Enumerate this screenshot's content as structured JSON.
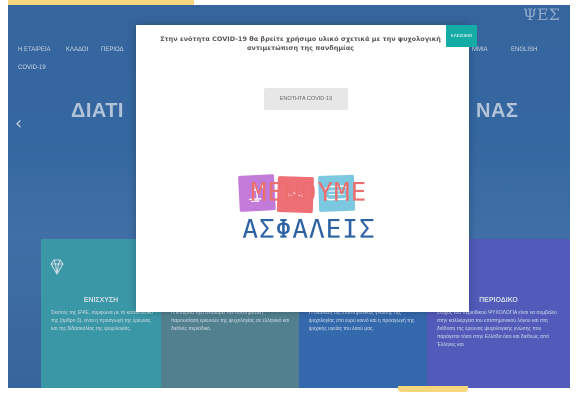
{
  "header": {
    "logo_text": "ΨΕΣ"
  },
  "nav": {
    "items": [
      "Η ΕΤΑΙΡΕΙΑ",
      "ΚΛΑΔΟΙ",
      "ΠΕΡΙΟΔ",
      "ΜΜΙΑ",
      "ENGLISH",
      "COVID-19"
    ]
  },
  "hero": {
    "title_left": "ΔΙΑΤΙ",
    "title_right": "ΝΑΣ"
  },
  "cards": [
    {
      "title": "ΕΝΙΣΧΥΣΗ",
      "text": "Σκοπός της ΕΨΕ, σύμφωνα με το καταστατικό της (άρθρο 3), είναι η προαγωγή της έρευνας και της διδασκαλίας της ψυχολογίας.",
      "color": "#3fa4b0"
    },
    {
      "title": "",
      "text": "Η Εταιρεία έχει αναλάβει την συστηματική παρουσίαση ερευνών της ψυχολογίας σε ελληνικό και διεθνές περιοδικό.",
      "color": "#5a8a95"
    },
    {
      "title": "",
      "text": "Η διάδοση της επιστημονικής γνώσης της ψυχολογίας στο ευρύ κοινό και η προαγωγή της ψυχικής υγείας του λαού μας.",
      "color": "#3970b8"
    },
    {
      "title": "ΠΕΡΙΟΔΙΚΟ",
      "text": "Στόχος του περιοδικού ΨΥΧΟΛΟΓΙΑ είναι να συμβάλει στην καλλιέργεια του επιστημονικού λόγου και στη διάδοση της έρευνας ψυχολογικής γνώσης που παράγεται τόσο στην Ελλάδα όσο και διεθνώς από Έλληνες και",
      "color": "#5b5fc7"
    }
  ],
  "modal": {
    "close_label": "ΚΛΕΙΣΙΜΟ",
    "message": "Στην ενότητα COVID-19 θα βρείτε χρήσιμο υλικό σχετικά με την ψυχολογική αντιμετώπιση της πανδημίας",
    "covid_button_label": "ΕΝΟΤΗΤΑ COVID-19",
    "poster_word1": "ΜΕΝΟΥΜΕ",
    "poster_word2": "ΑΣΦΑΛΕΙΣ"
  },
  "colors": {
    "accent": "#16aca6",
    "poster_red": "#ec6f6f",
    "poster_blue": "#2d62a3"
  }
}
